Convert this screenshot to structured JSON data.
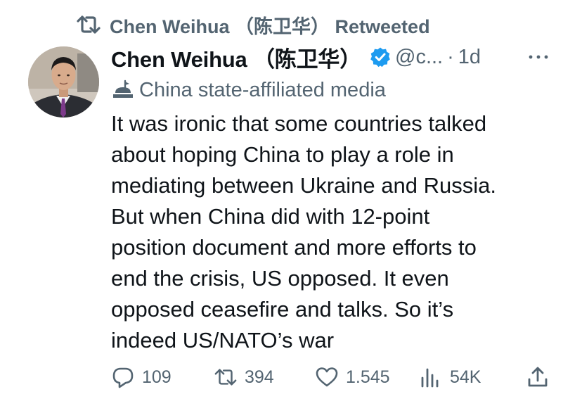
{
  "retweet_bar": {
    "text": "Chen Weihua （陈卫华） Retweeted",
    "icon": "retweet-icon"
  },
  "tweet": {
    "avatar_icon": "avatar-photo",
    "display_name": "Chen Weihua （陈卫华）",
    "verified_icon": "verified-badge-icon",
    "verified_color": "#1d9bf0",
    "handle": "@c...",
    "separator": "·",
    "time": "1d",
    "more_icon": "more-options-icon",
    "affiliation": {
      "icon": "government-building-icon",
      "label": "China state-affiliated media"
    },
    "text_lines": [
      "It was ironic that some countries talked",
      "about hoping China to play a role in",
      "mediating between Ukraine and Russia.",
      "But when China did with 12-point",
      "position document and more efforts to",
      "end the crisis, US opposed. It even",
      "opposed ceasefire and talks. So it’s",
      "indeed US/NATO’s war"
    ]
  },
  "actions": {
    "reply": {
      "icon": "reply-icon",
      "count": "109"
    },
    "retweet": {
      "icon": "retweet-icon",
      "count": "394"
    },
    "like": {
      "icon": "heart-icon",
      "count": "1.545"
    },
    "views": {
      "icon": "views-chart-icon",
      "count": "54K"
    },
    "share": {
      "icon": "share-icon"
    }
  },
  "colors": {
    "text_primary": "#0f1419",
    "text_secondary": "#536471",
    "accent": "#1d9bf0"
  }
}
